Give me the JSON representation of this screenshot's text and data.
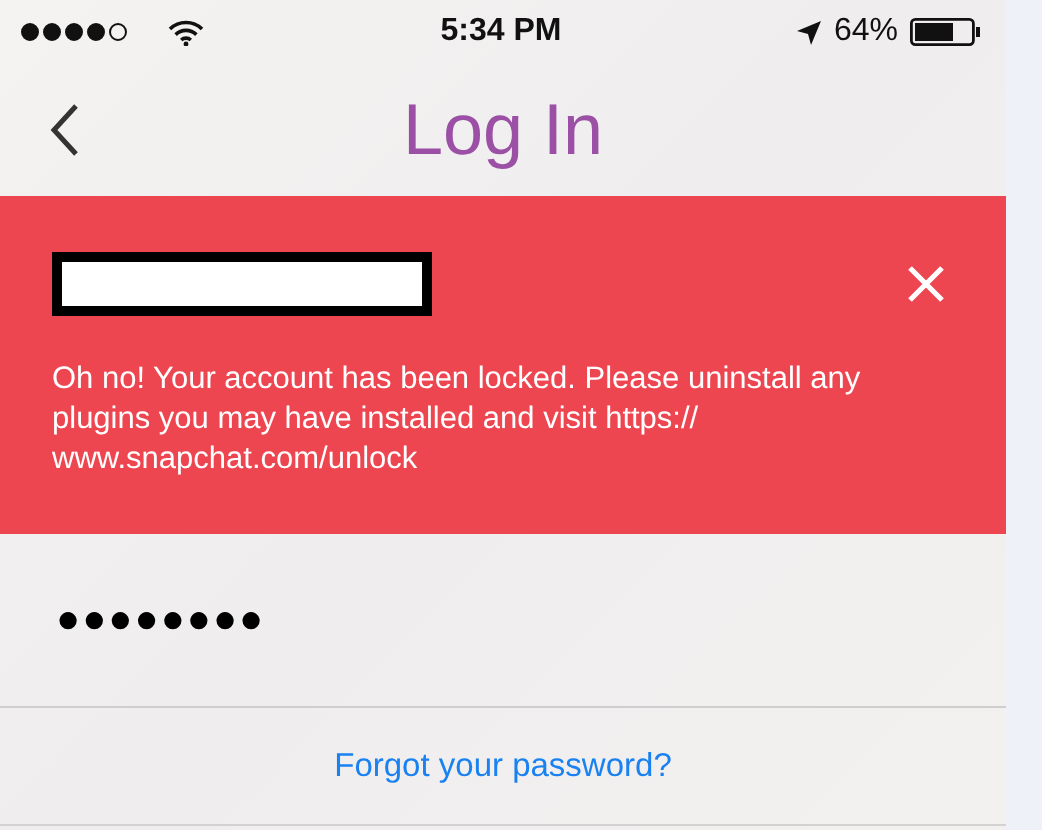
{
  "status_bar": {
    "time": "5:34 PM",
    "battery": "64%"
  },
  "nav_bar": {
    "title": "Log In"
  },
  "error_banner": {
    "message": "Oh no! Your account has been locked. Please uninstall any plugins you may have installed and visit https:// www.snapchat.com/unlock"
  },
  "password_field": {
    "value": "●●●●●●●●"
  },
  "forgot_link": "Forgot your password?"
}
